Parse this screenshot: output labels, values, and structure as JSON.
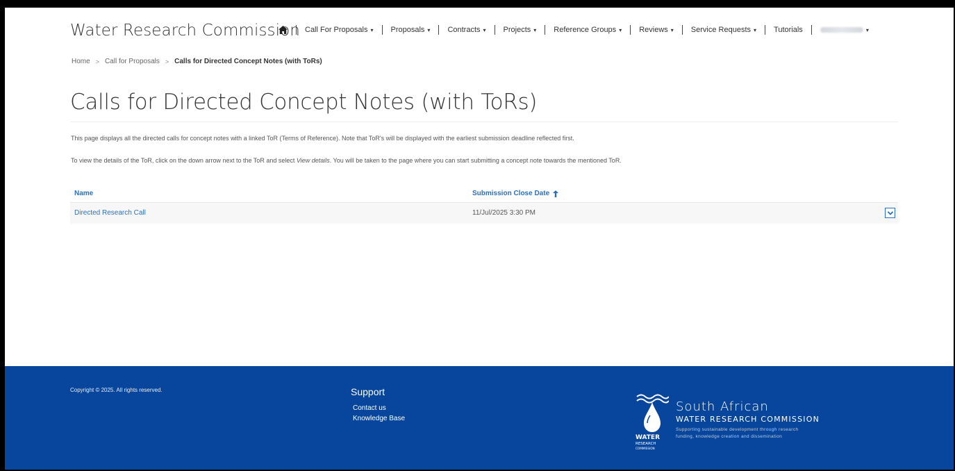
{
  "nav": {
    "brand": "Water Research Commission",
    "items": [
      {
        "label": "Call For Proposals",
        "has_caret": true
      },
      {
        "label": "Proposals",
        "has_caret": true
      },
      {
        "label": "Contracts",
        "has_caret": true
      },
      {
        "label": "Projects",
        "has_caret": true
      },
      {
        "label": "Reference Groups",
        "has_caret": true
      },
      {
        "label": "Reviews",
        "has_caret": true
      },
      {
        "label": "Service Requests",
        "has_caret": true
      },
      {
        "label": "Tutorials",
        "has_caret": false
      }
    ],
    "caret_glyph": "▾"
  },
  "breadcrumb": {
    "home": "Home",
    "parent": "Call for Proposals",
    "current": "Calls for Directed Concept Notes (with ToRs)",
    "separator": ">"
  },
  "page": {
    "title": "Calls for Directed Concept Notes (with ToRs)",
    "para1": "This page displays all the directed calls for concept notes with a linked ToR (Terms of Reference). Note that ToR's will be displayed with the earliest submission deadline reflected first.",
    "para2_pre": "To view the details of the ToR, click on the down arrow next to the ToR and select ",
    "para2_em": "View details",
    "para2_post": ". You will be taken to the page where you can start submitting a concept note towards the mentioned ToR."
  },
  "table": {
    "headers": {
      "name": "Name",
      "date": "Submission Close Date"
    },
    "rows": [
      {
        "name": "Directed Research Call",
        "date": "11/Jul/2025 3:30 PM"
      }
    ]
  },
  "footer": {
    "copyright": "Copyright © 2025. All rights reserved.",
    "support_title": "Support",
    "links": [
      "Contact us",
      "Knowledge Base"
    ],
    "logo": {
      "line1": "South African",
      "line2": "WATER RESEARCH COMMISSION",
      "tagline1": "Supporting sustainable development through research",
      "tagline2": "funding, knowledge creation and dissemination",
      "mark_word1": "WATER",
      "mark_word2": "RESEARCH",
      "mark_word3": "COMMISSION"
    }
  },
  "colors": {
    "link": "#2a6fbf",
    "footer_bg": "#07469c"
  },
  "icons": {
    "home": "home-icon",
    "sort": "arrow-up-icon",
    "dropdown": "chevron-down-icon"
  }
}
